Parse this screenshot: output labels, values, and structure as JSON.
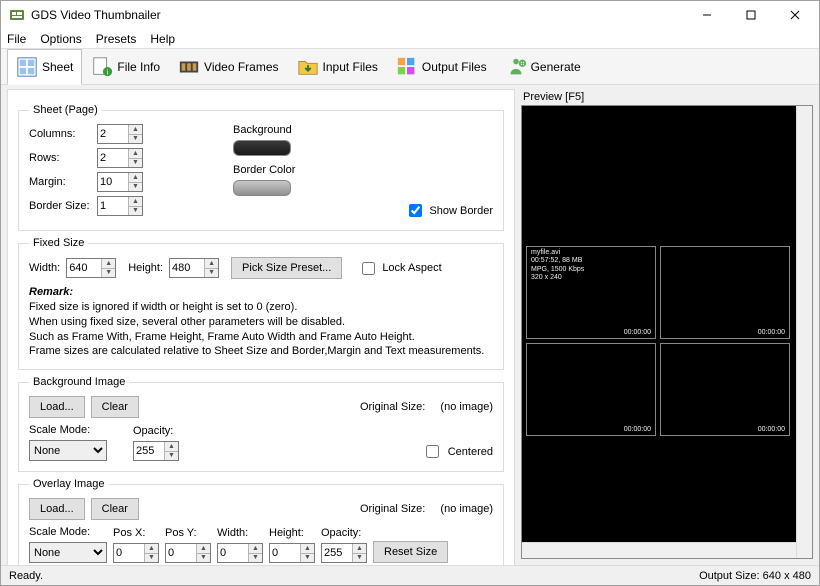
{
  "app": {
    "title": "GDS Video Thumbnailer"
  },
  "menu": {
    "file": "File",
    "options": "Options",
    "presets": "Presets",
    "help": "Help"
  },
  "tabs": {
    "sheet": "Sheet",
    "file_info": "File Info",
    "video_frames": "Video Frames",
    "input_files": "Input Files",
    "output_files": "Output Files",
    "generate": "Generate"
  },
  "sheet_page": {
    "legend": "Sheet (Page)",
    "columns_label": "Columns:",
    "columns": "2",
    "rows_label": "Rows:",
    "rows": "2",
    "margin_label": "Margin:",
    "margin": "10",
    "border_label": "Border Size:",
    "border": "1",
    "background_label": "Background",
    "background_color": "#2a2a2a",
    "border_color_label": "Border Color",
    "border_color": "#a8a8a8",
    "show_border_label": "Show Border",
    "show_border": true
  },
  "fixed_size": {
    "legend": "Fixed Size",
    "width_label": "Width:",
    "width": "640",
    "height_label": "Height:",
    "height": "480",
    "pick_preset": "Pick Size Preset...",
    "lock_aspect_label": "Lock Aspect",
    "lock_aspect": false,
    "remark_title": "Remark:",
    "remark_l1": "Fixed size is ignored if width or height is set to 0 (zero).",
    "remark_l2": "When using fixed size, several other parameters will be disabled.",
    "remark_l3": "Such as Frame With, Frame Height, Frame Auto Width and Frame Auto Height.",
    "remark_l4": "Frame sizes are calculated relative to Sheet Size and Border,Margin and Text measurements."
  },
  "bg_image": {
    "legend": "Background Image",
    "load": "Load...",
    "clear": "Clear",
    "orig_size_label": "Original Size:",
    "orig_size": "(no image)",
    "scale_mode_label": "Scale Mode:",
    "scale_mode": "None",
    "opacity_label": "Opacity:",
    "opacity": "255",
    "centered_label": "Centered",
    "centered": false
  },
  "ov_image": {
    "legend": "Overlay Image",
    "load": "Load...",
    "clear": "Clear",
    "orig_size_label": "Original Size:",
    "orig_size": "(no image)",
    "scale_mode_label": "Scale Mode:",
    "scale_mode": "None",
    "posx_label": "Pos X:",
    "posx": "0",
    "posy_label": "Pos Y:",
    "posy": "0",
    "width_label": "Width:",
    "width": "0",
    "height_label": "Height:",
    "height": "0",
    "opacity_label": "Opacity:",
    "opacity": "255",
    "reset": "Reset Size"
  },
  "preview": {
    "title": "Preview  [F5]",
    "thumb_info": "myfile.avi\n00:57:52, 88 MB\nMPG, 1500 Kbps\n320 x 240",
    "timestamp": "00:00:00"
  },
  "status": {
    "ready": "Ready.",
    "output": "Output Size: 640 x 480"
  }
}
